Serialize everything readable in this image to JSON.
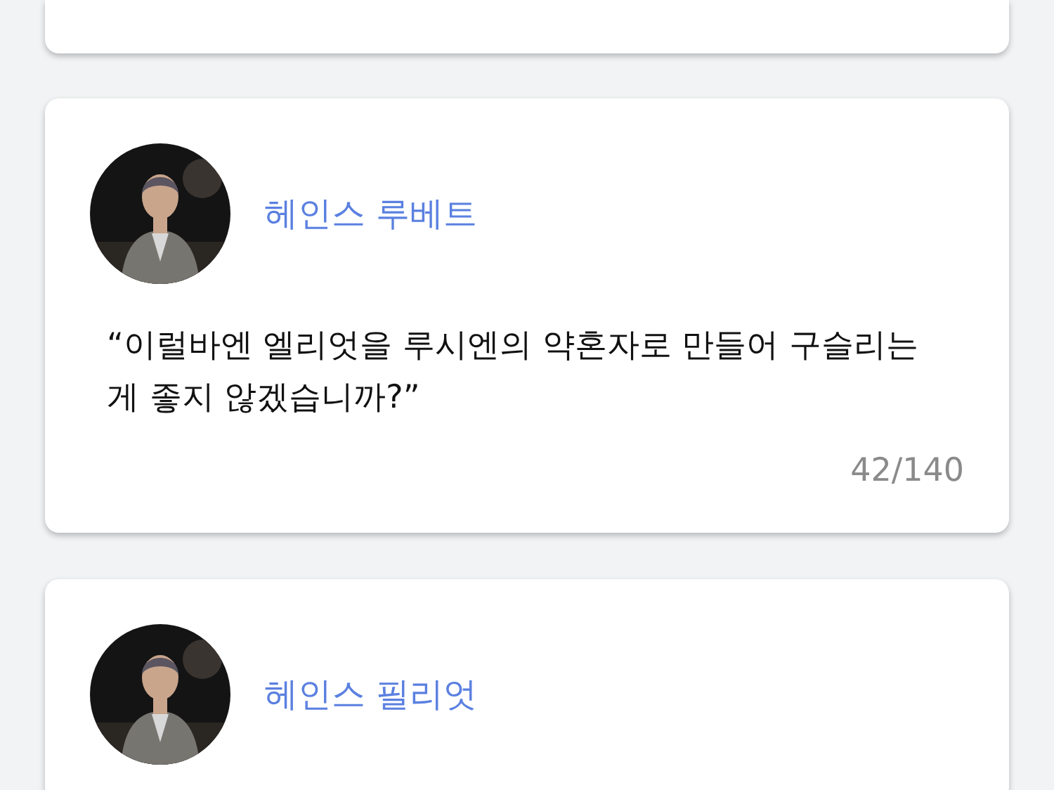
{
  "cards": [
    {
      "name": "헤인스 루베트",
      "quote": "“이럴바엔 엘리엇을 루시엔의 약혼자로 만들어 구슬리는 게 좋지 않겠습니까?”",
      "counter": "42/140"
    },
    {
      "name": "헤인스 필리엇"
    }
  ]
}
